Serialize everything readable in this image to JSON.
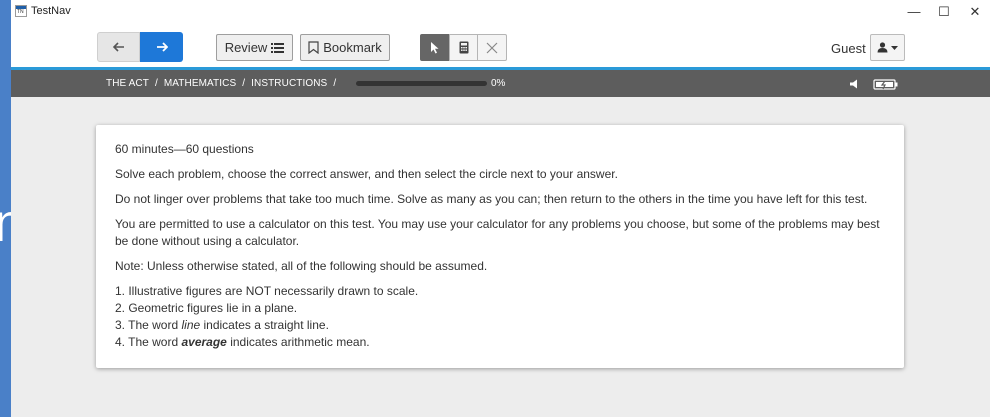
{
  "background": {
    "partial_letter": "n"
  },
  "window": {
    "title": "TestNav",
    "controls": {
      "minimize": "—",
      "maximize": "☐",
      "close": "✕"
    }
  },
  "toolbar": {
    "back_icon": "arrow-left-icon",
    "forward_icon": "arrow-right-icon",
    "review_label": "Review",
    "bookmark_label": "Bookmark",
    "user_label": "Guest",
    "accent_color": "#1e78d8"
  },
  "breadcrumb": {
    "items": [
      "THE ACT",
      "MATHEMATICS",
      "INSTRUCTIONS"
    ],
    "separator": "/",
    "progress_percent": 0,
    "progress_text": "0%"
  },
  "instructions": {
    "header": "60 minutes—60 questions",
    "p1": "Solve each problem, choose the correct answer, and then select the circle next to your answer.",
    "p2": "Do not linger over problems that take too much time. Solve as many as you can; then return to the others in the time you have left for this test.",
    "p3": "You are permitted to use a calculator on this test. You may use your calculator for any problems you choose, but some of the problems may best be done without using a calculator.",
    "p4": "Note: Unless otherwise stated, all of the following should be assumed.",
    "list": {
      "item1": "1. Illustrative figures are NOT necessarily drawn to scale.",
      "item2": "2. Geometric figures lie in a plane.",
      "item3_pre": "3. The word ",
      "item3_em": "line",
      "item3_post": " indicates a straight line.",
      "item4_pre": "4. The word ",
      "item4_em": "average",
      "item4_post": " indicates arithmetic mean."
    }
  }
}
